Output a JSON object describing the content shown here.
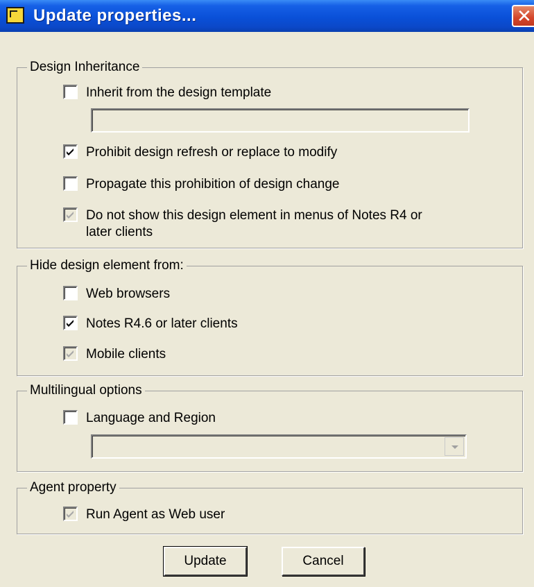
{
  "window": {
    "title": "Update properties...",
    "close_glyph": "✕"
  },
  "design_inheritance": {
    "legend": "Design Inheritance",
    "inherit_label": "Inherit from the design template",
    "template_name_value": "",
    "prohibit_label": "Prohibit design refresh or replace to modify",
    "propagate_label": "Propagate this prohibition of design change",
    "hide_menus_label_line1": "Do not show this design element in menus of Notes R4 or",
    "hide_menus_label_line2": "later clients"
  },
  "hide_from": {
    "legend": "Hide design element from:",
    "web_label": "Web browsers",
    "notes_label": "Notes R4.6 or later clients",
    "mobile_label": "Mobile clients"
  },
  "multilingual": {
    "legend": "Multilingual options",
    "language_label": "Language and Region",
    "language_value": ""
  },
  "agent": {
    "legend": "Agent property",
    "run_as_web_label": "Run Agent as Web user"
  },
  "buttons": {
    "update": "Update",
    "cancel": "Cancel"
  },
  "colors": {
    "titlebar": "#0a50d8",
    "dialog_bg": "#ece9d8",
    "close_button": "#d4452a"
  },
  "states": {
    "inherit": false,
    "prohibit": true,
    "propagate": false,
    "hide_menus": true,
    "web_browsers": false,
    "notes_clients": true,
    "mobile_clients": true,
    "language_region": false,
    "run_as_web_user": true
  }
}
